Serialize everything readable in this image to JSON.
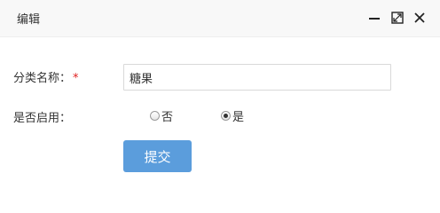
{
  "window": {
    "title": "编辑",
    "controls": {
      "minimize_icon": "minimize-icon",
      "maximize_icon": "maximize-icon",
      "close_icon": "close-icon"
    }
  },
  "form": {
    "category_name": {
      "label": "分类名称：",
      "required_mark": "*",
      "value": "糖果"
    },
    "enabled": {
      "label": "是否启用：",
      "options": [
        {
          "label": "否",
          "checked": false
        },
        {
          "label": "是",
          "checked": true
        }
      ]
    },
    "submit_label": "提交"
  },
  "colors": {
    "accent": "#5b9ddc",
    "required": "#e02020",
    "titlebar_bg": "#f8f8f8"
  }
}
